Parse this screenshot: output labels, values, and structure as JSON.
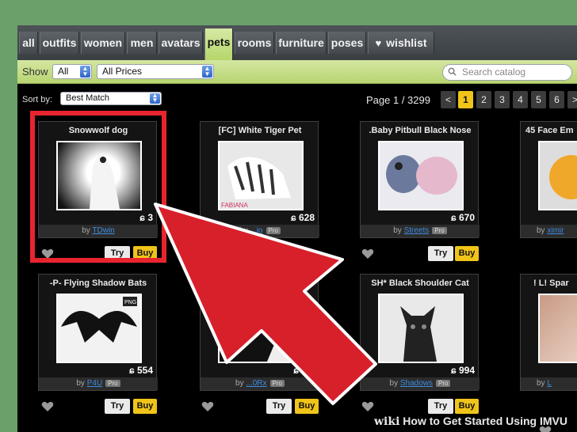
{
  "tabs": [
    {
      "label": "all",
      "active": false
    },
    {
      "label": "outfits",
      "active": false
    },
    {
      "label": "women",
      "active": false
    },
    {
      "label": "men",
      "active": false
    },
    {
      "label": "avatars",
      "active": false
    },
    {
      "label": "pets",
      "active": true
    },
    {
      "label": "rooms",
      "active": false
    },
    {
      "label": "furniture",
      "active": false
    },
    {
      "label": "poses",
      "active": false
    },
    {
      "label": "wishlist",
      "active": false,
      "icon": "heart-icon"
    }
  ],
  "filter": {
    "show_label": "Show",
    "show_value": "All",
    "price_value": "All Prices",
    "search_placeholder": "Search catalog"
  },
  "sort": {
    "label": "Sort by:",
    "value": "Best Match"
  },
  "pagination": {
    "info": "Page 1 / 3299",
    "prev": "<",
    "pages": [
      "1",
      "2",
      "3",
      "4",
      "5",
      "6"
    ],
    "next": ">",
    "current": "1"
  },
  "products": [
    {
      "title": "Snowwolf dog",
      "price": "3",
      "creator": "TDwin",
      "pro": false
    },
    {
      "title": "[FC] White Tiger Pet",
      "price": "628",
      "creator": "...io",
      "pro": true
    },
    {
      "title": ".Baby Pitbull Black Nose",
      "price": "670",
      "creator": "Streets",
      "pro": true
    },
    {
      "title": "45 Face Em",
      "price": "",
      "creator": "ximir",
      "pro": false
    },
    {
      "title": "-P- Flying Shadow Bats",
      "price": "554",
      "creator": "P4U",
      "pro": true
    },
    {
      "title": "",
      "price": "1,3",
      "creator": "...0Rx",
      "pro": true
    },
    {
      "title": "SH* Black Shoulder Cat",
      "price": "994",
      "creator": "Shadows",
      "pro": true
    },
    {
      "title": "! L! Spar",
      "price": "",
      "creator": "L",
      "pro": false
    }
  ],
  "buttons": {
    "try": "Try",
    "buy": "Buy",
    "by": "by",
    "pro": "Pro"
  },
  "thumb_labels": {
    "tiger_watermark": "FABIANA",
    "bats_badge": "PNG"
  },
  "currency_symbol": "ɕ",
  "footer": {
    "wiki": "wiki",
    "how": "How to Get Started Using IMVU"
  },
  "colors": {
    "accent": "#f0c419",
    "tab_active": "#b6d66a",
    "highlight": "#e8252f",
    "link": "#3d8be0"
  }
}
